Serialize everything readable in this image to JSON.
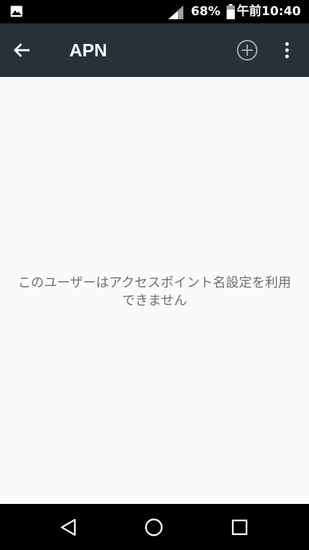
{
  "status_bar": {
    "left_icon": "gallery-icon",
    "signal_icon": "cell-signal-icon",
    "battery_percent": "68%",
    "battery_icon": "battery-icon",
    "time": "午前10:40"
  },
  "toolbar": {
    "back_icon": "arrow-back-icon",
    "title": "APN",
    "add_icon": "add-circle-icon",
    "overflow_icon": "more-vert-icon"
  },
  "content": {
    "message": "このユーザーはアクセスポイント名設定を利用できません"
  },
  "nav_bar": {
    "back_icon": "nav-back-triangle-icon",
    "home_icon": "nav-home-circle-icon",
    "recents_icon": "nav-recents-square-icon"
  },
  "colors": {
    "toolbar_bg": "#263238",
    "status_bar_bg": "#000000",
    "content_bg": "#fafafa",
    "message_text": "#707070",
    "nav_bar_bg": "#000000"
  }
}
